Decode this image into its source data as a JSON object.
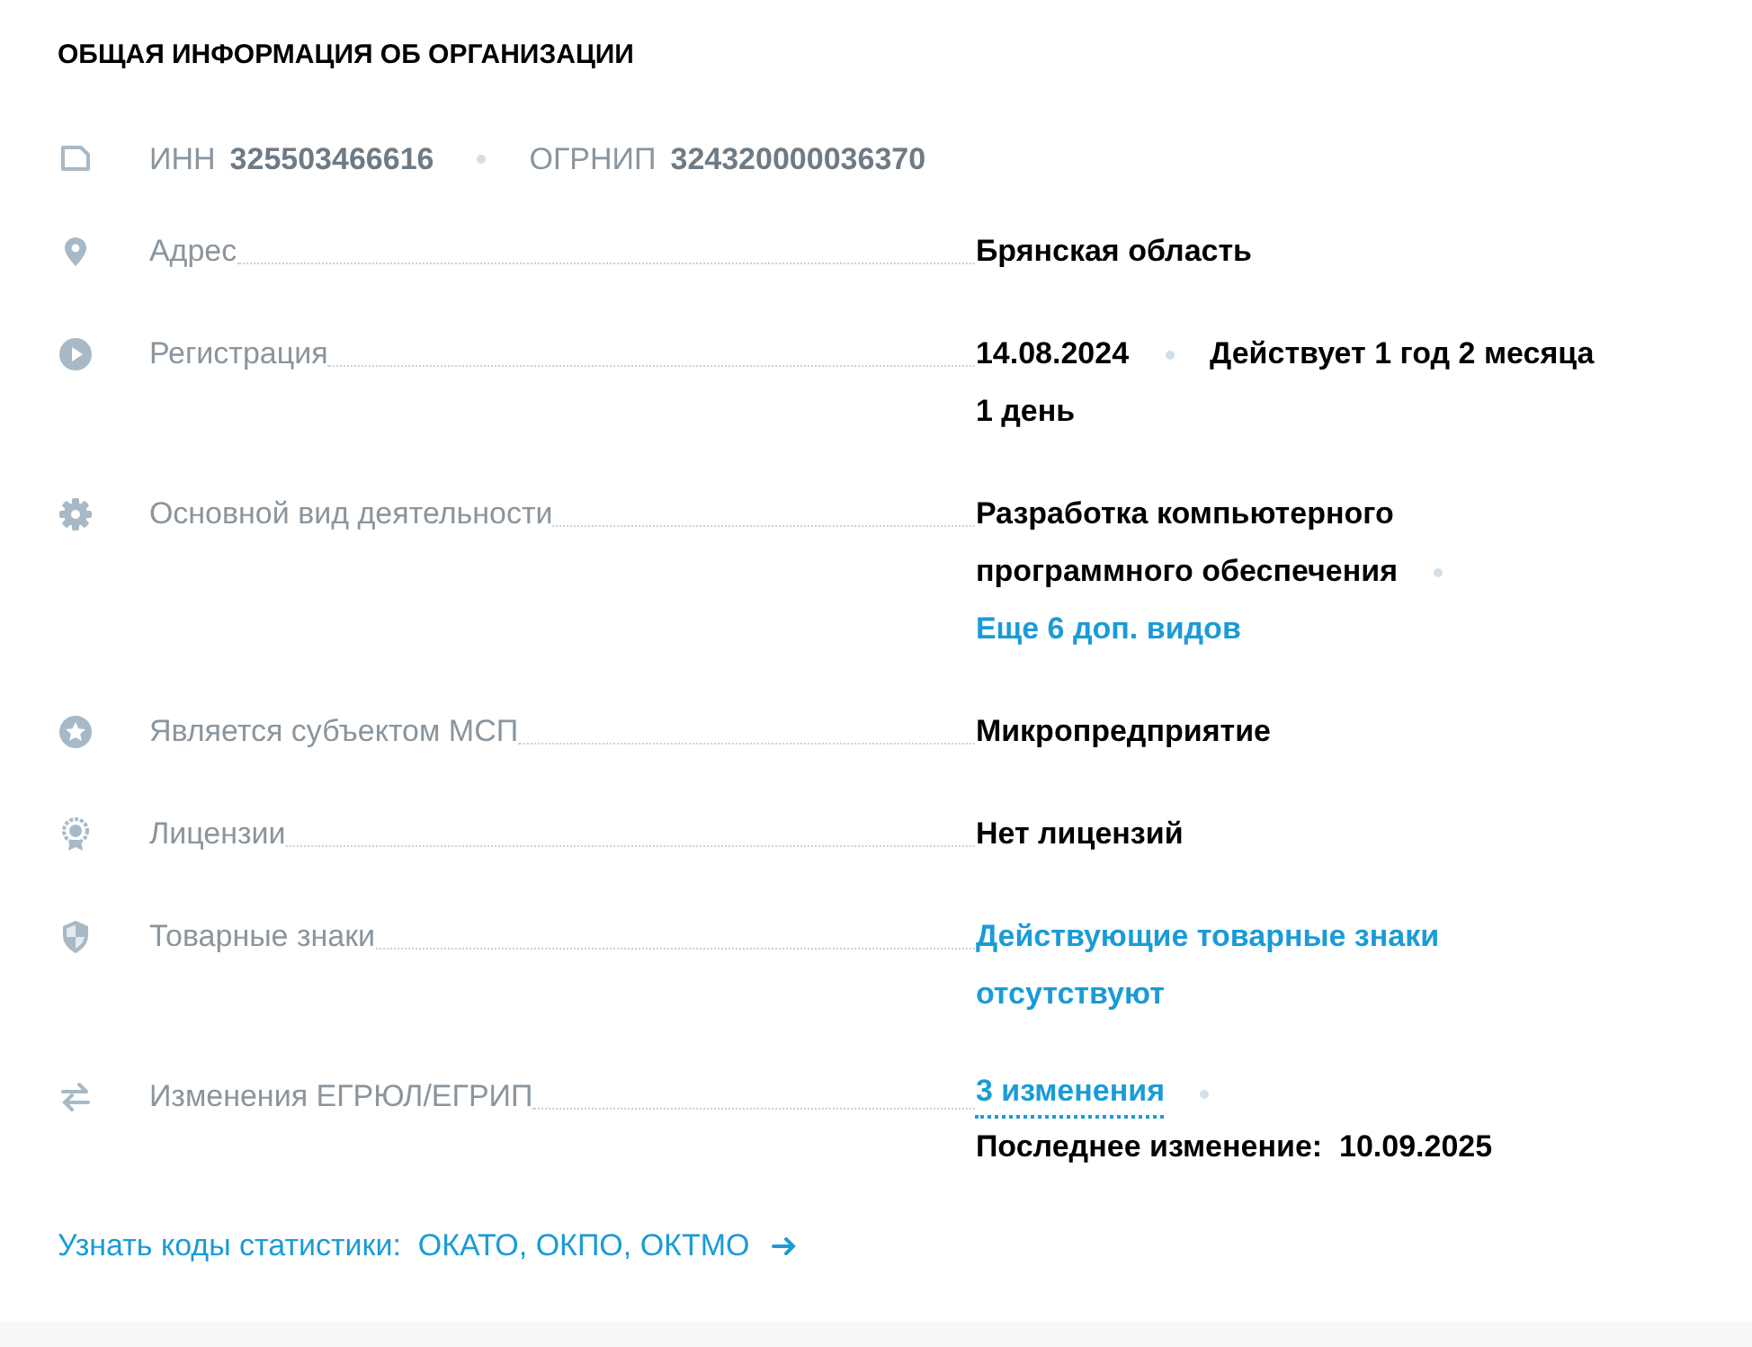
{
  "title": "ОБЩАЯ ИНФОРМАЦИЯ ОБ ОРГАНИЗАЦИИ",
  "ids": [
    {
      "label": "ИНН",
      "value": "325503466616"
    },
    {
      "label": "ОГРНИП",
      "value": "324320000036370"
    }
  ],
  "rows": [
    {
      "label": "Адрес",
      "lines": [
        [
          {
            "kind": "text",
            "text": "Брянская область"
          }
        ]
      ]
    },
    {
      "label": "Регистрация",
      "lines": [
        [
          {
            "kind": "text",
            "text": "14.08.2024"
          },
          {
            "kind": "dot"
          },
          {
            "kind": "text",
            "text": "Действует 1 год 2 месяца"
          }
        ],
        [
          {
            "kind": "text",
            "text": "1 день"
          }
        ]
      ]
    },
    {
      "label": "Основной вид деятельности",
      "lines": [
        [
          {
            "kind": "text",
            "text": "Разработка компьютерного"
          }
        ],
        [
          {
            "kind": "text",
            "text": "программного обеспечения"
          },
          {
            "kind": "dot"
          }
        ],
        [
          {
            "kind": "link",
            "text": "Еще 6 доп. видов"
          }
        ]
      ]
    },
    {
      "label": "Является субъектом МСП",
      "lines": [
        [
          {
            "kind": "text",
            "text": "Микропредприятие"
          }
        ]
      ]
    },
    {
      "label": "Лицензии",
      "lines": [
        [
          {
            "kind": "text",
            "text": "Нет лицензий"
          }
        ]
      ]
    },
    {
      "label": "Товарные знаки",
      "lines": [
        [
          {
            "kind": "wrapped_link",
            "text": "Действующие товарные знаки отсутствуют"
          }
        ]
      ]
    },
    {
      "label": "Изменения ЕГРЮЛ/ЕГРИП",
      "lines": [
        [
          {
            "kind": "dotted_link",
            "text": "3 изменения"
          },
          {
            "kind": "dot"
          }
        ],
        [
          {
            "kind": "text",
            "text": "Последнее изменение:  10.09.2025"
          }
        ]
      ]
    }
  ],
  "footer_link": "Узнать коды статистики:  ОКАТО, ОКПО, ОКТМО"
}
